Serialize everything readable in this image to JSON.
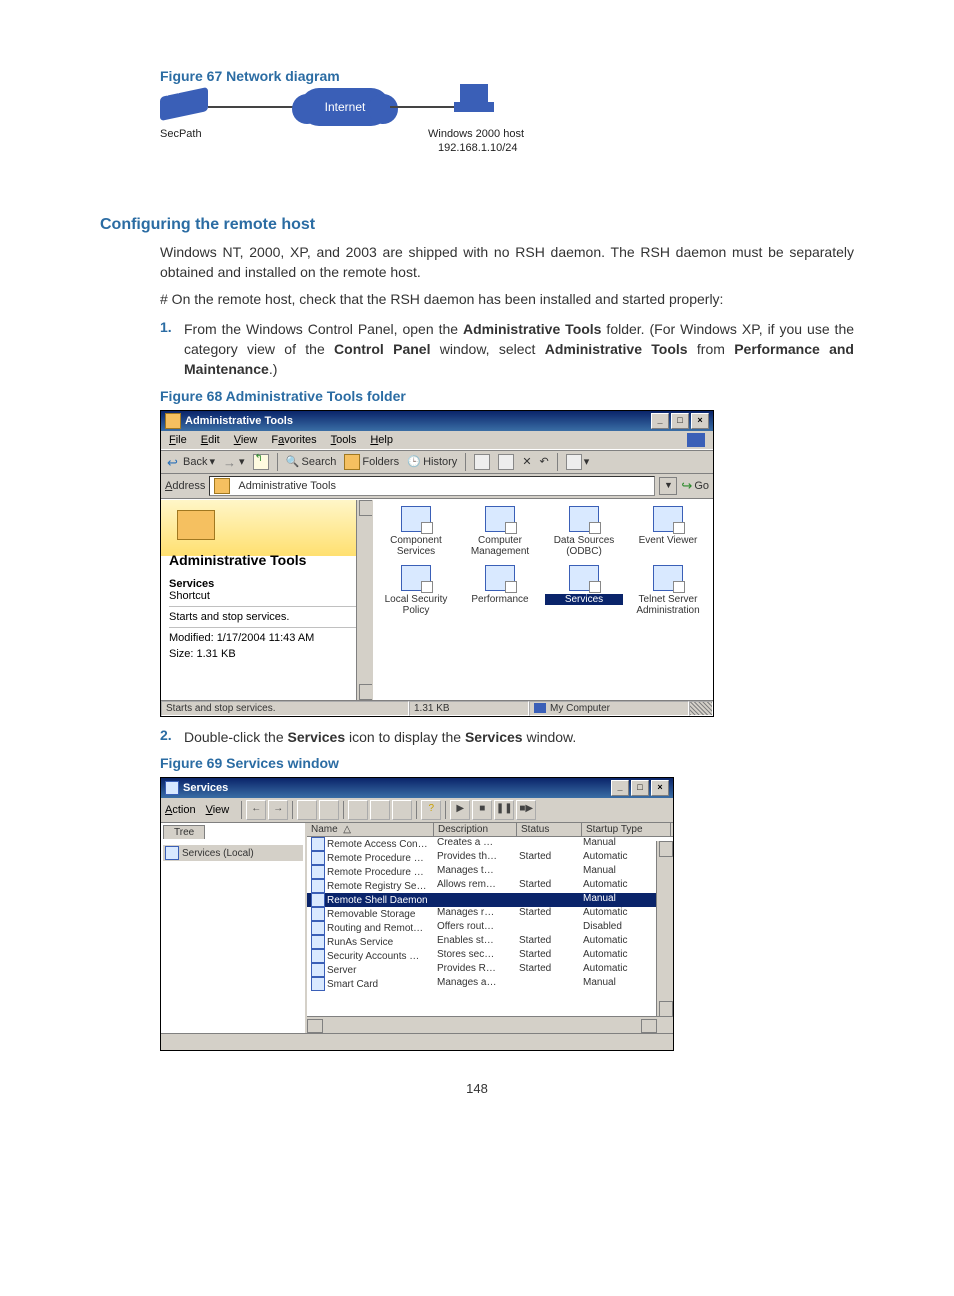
{
  "fig67": {
    "caption": "Figure 67 Network diagram",
    "internet": "Internet",
    "secpath": "SecPath",
    "host_line1": "Windows 2000 host",
    "host_line2": "192.168.1.10/24"
  },
  "section_heading": "Configuring the remote host",
  "para1": "Windows NT, 2000, XP, and 2003 are shipped with no RSH daemon. The RSH daemon must be separately obtained and installed on the remote host.",
  "para2": "# On the remote host, check that the RSH daemon has been installed and started properly:",
  "step1": {
    "num": "1.",
    "text_a": "From the Windows Control Panel, open the ",
    "b1": "Administrative Tools",
    "text_b": " folder. (For Windows XP, if you use the category view of the ",
    "b2": "Control Panel",
    "text_c": " window, select ",
    "b3": "Administrative Tools",
    "text_d": " from ",
    "b4": "Performance and Maintenance",
    "text_e": ".)"
  },
  "fig68": {
    "caption": "Figure 68 Administrative Tools folder"
  },
  "adminwin": {
    "title": "Administrative Tools",
    "menus": [
      "File",
      "Edit",
      "View",
      "Favorites",
      "Tools",
      "Help"
    ],
    "tool_back": "Back",
    "tool_search": "Search",
    "tool_folders": "Folders",
    "tool_history": "History",
    "addr_label": "Address",
    "addr_value": "Administrative Tools",
    "go_label": "Go",
    "left_title": "Administrative Tools",
    "left_services": "Services",
    "left_shortcut": "Shortcut",
    "left_starts": "Starts and stop services.",
    "left_modified": "Modified: 1/17/2004 11:43 AM",
    "left_size": "Size: 1.31 KB",
    "icons": [
      {
        "label": "Component Services"
      },
      {
        "label": "Computer Management"
      },
      {
        "label": "Data Sources (ODBC)"
      },
      {
        "label": "Event Viewer"
      },
      {
        "label": "Local Security Policy"
      },
      {
        "label": "Performance"
      },
      {
        "label": "Services",
        "selected": true
      },
      {
        "label": "Telnet Server Administration"
      }
    ],
    "status_left": "Starts and stop services.",
    "status_size": "1.31 KB",
    "status_loc": "My Computer"
  },
  "step2": {
    "num": "2.",
    "text_a": "Double-click the ",
    "b1": "Services",
    "text_b": " icon to display the ",
    "b2": "Services",
    "text_c": " window."
  },
  "fig69": {
    "caption": "Figure 69 Services window"
  },
  "svcwin": {
    "title": "Services",
    "menus": [
      "Action",
      "View"
    ],
    "tree_tab": "Tree",
    "tree_item": "Services (Local)",
    "cols": {
      "name": "Name",
      "desc": "Description",
      "status": "Status",
      "type": "Startup Type"
    },
    "rows": [
      {
        "name": "Remote Access Con…",
        "desc": "Creates a …",
        "status": "",
        "type": "Manual"
      },
      {
        "name": "Remote Procedure …",
        "desc": "Provides th…",
        "status": "Started",
        "type": "Automatic"
      },
      {
        "name": "Remote Procedure …",
        "desc": "Manages t…",
        "status": "",
        "type": "Manual"
      },
      {
        "name": "Remote Registry Se…",
        "desc": "Allows rem…",
        "status": "Started",
        "type": "Automatic"
      },
      {
        "name": "Remote Shell Daemon",
        "desc": "",
        "status": "",
        "type": "Manual",
        "selected": true
      },
      {
        "name": "Removable Storage",
        "desc": "Manages r…",
        "status": "Started",
        "type": "Automatic"
      },
      {
        "name": "Routing and Remot…",
        "desc": "Offers rout…",
        "status": "",
        "type": "Disabled"
      },
      {
        "name": "RunAs Service",
        "desc": "Enables st…",
        "status": "Started",
        "type": "Automatic"
      },
      {
        "name": "Security Accounts …",
        "desc": "Stores sec…",
        "status": "Started",
        "type": "Automatic"
      },
      {
        "name": "Server",
        "desc": "Provides R…",
        "status": "Started",
        "type": "Automatic"
      },
      {
        "name": "Smart Card",
        "desc": "Manages a…",
        "status": "",
        "type": "Manual"
      }
    ]
  },
  "page_number": "148"
}
